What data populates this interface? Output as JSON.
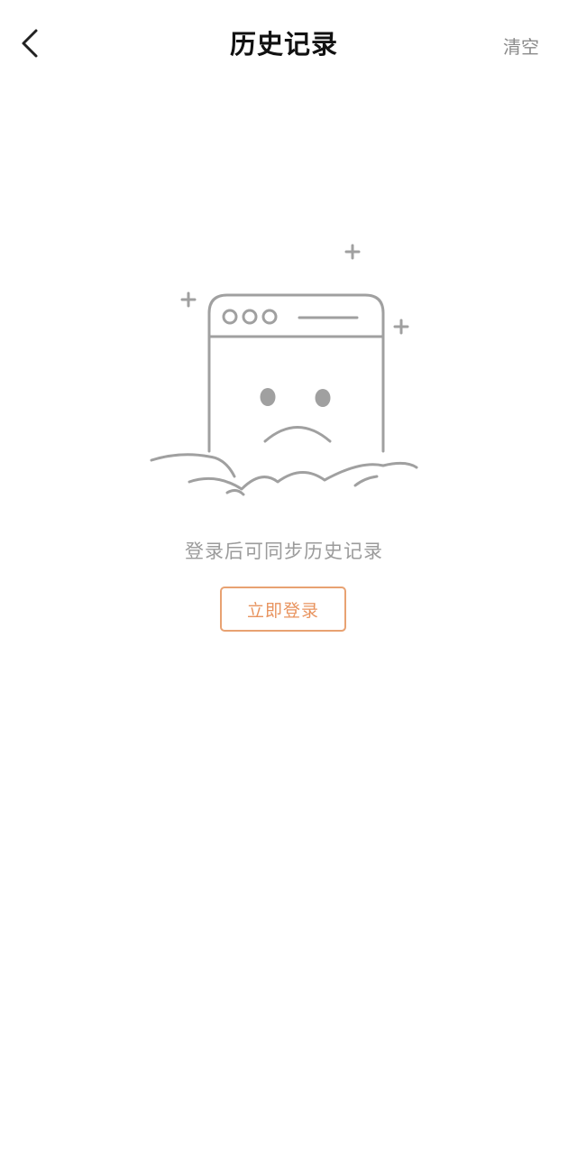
{
  "header": {
    "title": "历史记录",
    "clear_label": "清空"
  },
  "empty_state": {
    "illustration_icon": "sad-browser-icon",
    "message": "登录后可同步历史记录",
    "login_button_label": "立即登录"
  },
  "colors": {
    "accent": "#e8935e",
    "accent_border": "#e8a272",
    "muted_text": "#9b9b9b",
    "illustration_stroke": "#a0a0a0"
  }
}
